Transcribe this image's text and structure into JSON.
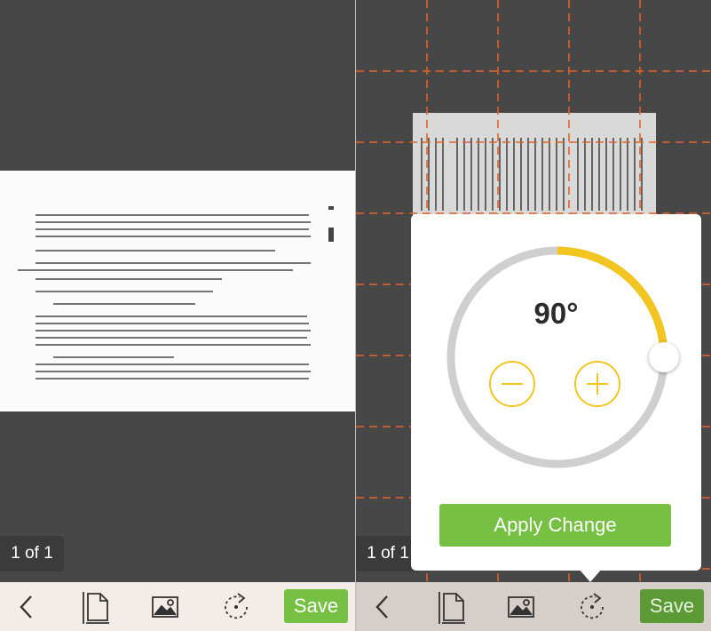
{
  "left_panel": {
    "page_counter": "1 of 1",
    "toolbar": {
      "back_icon": "chevron-left-icon",
      "pages_icon": "page-crop-icon",
      "image_icon": "image-filter-icon",
      "rotate_icon": "rotate-icon",
      "save_label": "Save"
    }
  },
  "right_panel": {
    "page_counter": "1 of 1",
    "toolbar": {
      "back_icon": "chevron-left-icon",
      "pages_icon": "page-crop-icon",
      "image_icon": "image-filter-icon",
      "rotate_icon": "rotate-icon",
      "save_label": "Save"
    },
    "rotate_popover": {
      "angle_label": "90°",
      "rotation_degrees": 90,
      "decrease_icon": "minus-icon",
      "increase_icon": "plus-icon",
      "apply_label": "Apply Change"
    }
  },
  "colors": {
    "background": "#474747",
    "accent_green": "#76c043",
    "accent_yellow": "#f3c520",
    "grid_dash": "#e0622a",
    "toolbar_bg": "#f4ece6"
  }
}
